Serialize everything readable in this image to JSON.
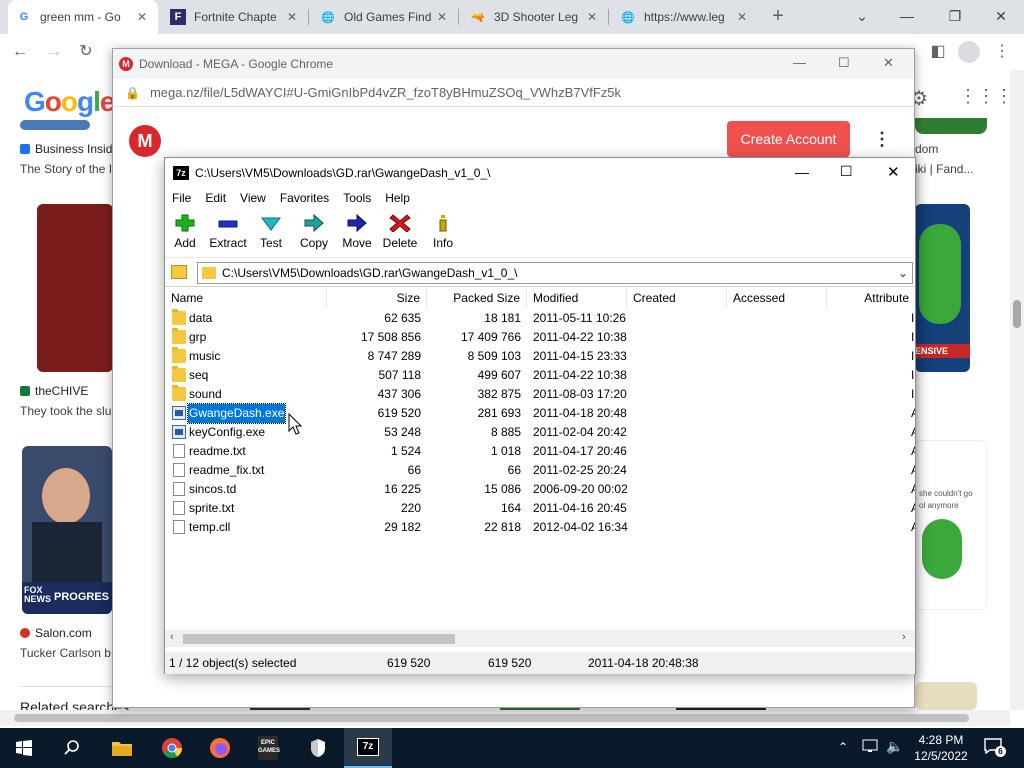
{
  "chrome": {
    "tabs": [
      {
        "title": "green mm - Go",
        "favicon": "google-g",
        "active": true
      },
      {
        "title": "Fortnite Chapte",
        "favicon": "fortnite-f",
        "active": false
      },
      {
        "title": "Old Games Find",
        "favicon": "globe",
        "active": false
      },
      {
        "title": "3D Shooter Leg",
        "favicon": "gun",
        "active": false
      },
      {
        "title": "https://www.leg",
        "favicon": "globe",
        "active": false
      }
    ],
    "new_tab": "+",
    "google": {
      "logo": "Google",
      "results": [
        {
          "source": "Business Insid",
          "snippet": "The Story of the I"
        },
        {
          "source": "theCHIVE",
          "snippet": "They took the slu"
        },
        {
          "source": "Salon.com",
          "snippet": "Tucker Carlson b"
        }
      ],
      "right_results": [
        {
          "source": "dom",
          "snippet": "iki | Fand..."
        }
      ],
      "right_thumb_texts": [
        "ENSIVE",
        "she couldn't go",
        "ol anymore"
      ],
      "thumb_texts": [
        "FOX NEWS",
        "PROGRES"
      ],
      "related": "Related searches"
    }
  },
  "mega": {
    "window_title": "Download - MEGA - Google Chrome",
    "url": "mega.nz/file/L5dWAYCI#U-GmiGnIbPd4vZR_fzoT8yBHmuZSOq_VWhzB7VfFz5k",
    "logo_letter": "M",
    "create_account": "Create Account",
    "kebab": "⋮"
  },
  "sevenzip": {
    "title": "C:\\Users\\VM5\\Downloads\\GD.rar\\GwangeDash_v1_0_\\",
    "app_icon": "7z",
    "menu": [
      "File",
      "Edit",
      "View",
      "Favorites",
      "Tools",
      "Help"
    ],
    "toolbar": [
      {
        "label": "Add",
        "icon": "plus-icon",
        "color": "#1db31d"
      },
      {
        "label": "Extract",
        "icon": "minus-icon",
        "color": "#2233cc"
      },
      {
        "label": "Test",
        "icon": "check-icon",
        "color": "#21b5c9"
      },
      {
        "label": "Copy",
        "icon": "copy-arrow-icon",
        "color": "#22a0a0"
      },
      {
        "label": "Move",
        "icon": "move-arrow-icon",
        "color": "#1b2aa8"
      },
      {
        "label": "Delete",
        "icon": "delete-x-icon",
        "color": "#d11a1a"
      },
      {
        "label": "Info",
        "icon": "info-icon",
        "color": "#c8a800"
      }
    ],
    "path": "C:\\Users\\VM5\\Downloads\\GD.rar\\GwangeDash_v1_0_\\",
    "columns": [
      "Name",
      "Size",
      "Packed Size",
      "Modified",
      "Created",
      "Accessed",
      "Attribute"
    ],
    "files": [
      {
        "name": "data",
        "type": "folder",
        "size": "62 635",
        "packed": "18 181",
        "modified": "2011-05-11 10:26",
        "attr": "I"
      },
      {
        "name": "grp",
        "type": "folder",
        "size": "17 508 856",
        "packed": "17 409 766",
        "modified": "2011-04-22 10:38",
        "attr": "I"
      },
      {
        "name": "music",
        "type": "folder",
        "size": "8 747 289",
        "packed": "8 509 103",
        "modified": "2011-04-15 23:33",
        "attr": "I"
      },
      {
        "name": "seq",
        "type": "folder",
        "size": "507 118",
        "packed": "499 607",
        "modified": "2011-04-22 10:38",
        "attr": "I"
      },
      {
        "name": "sound",
        "type": "folder",
        "size": "437 306",
        "packed": "382 875",
        "modified": "2011-08-03 17:20",
        "attr": "I"
      },
      {
        "name": "GwangeDash.exe",
        "type": "exe",
        "size": "619 520",
        "packed": "281 693",
        "modified": "2011-04-18 20:48",
        "attr": "A",
        "selected": true
      },
      {
        "name": "keyConfig.exe",
        "type": "exe",
        "size": "53 248",
        "packed": "8 885",
        "modified": "2011-02-04 20:42",
        "attr": "A"
      },
      {
        "name": "readme.txt",
        "type": "file",
        "size": "1 524",
        "packed": "1 018",
        "modified": "2011-04-17 20:46",
        "attr": "A"
      },
      {
        "name": "readme_fix.txt",
        "type": "file",
        "size": "66",
        "packed": "66",
        "modified": "2011-02-25 20:24",
        "attr": "A"
      },
      {
        "name": "sincos.td",
        "type": "file",
        "size": "16 225",
        "packed": "15 086",
        "modified": "2006-09-20 00:02",
        "attr": "A"
      },
      {
        "name": "sprite.txt",
        "type": "file",
        "size": "220",
        "packed": "164",
        "modified": "2011-04-16 20:45",
        "attr": "A"
      },
      {
        "name": "temp.cll",
        "type": "file",
        "size": "29 182",
        "packed": "22 818",
        "modified": "2012-04-02 16:34",
        "attr": "A"
      }
    ],
    "status": {
      "selected": "1 / 12 object(s) selected",
      "size": "619 520",
      "packed": "619 520",
      "modified": "2011-04-18 20:48:38"
    }
  },
  "taskbar": {
    "clock_time": "4:28 PM",
    "clock_date": "12/5/2022",
    "notification_count": "6",
    "apps": [
      "windows-start",
      "search",
      "file-explorer",
      "chrome",
      "firefox",
      "epic-games",
      "security",
      "7zip"
    ],
    "epic_label": "EPIC\nGAMES",
    "sz_label": "7z"
  }
}
